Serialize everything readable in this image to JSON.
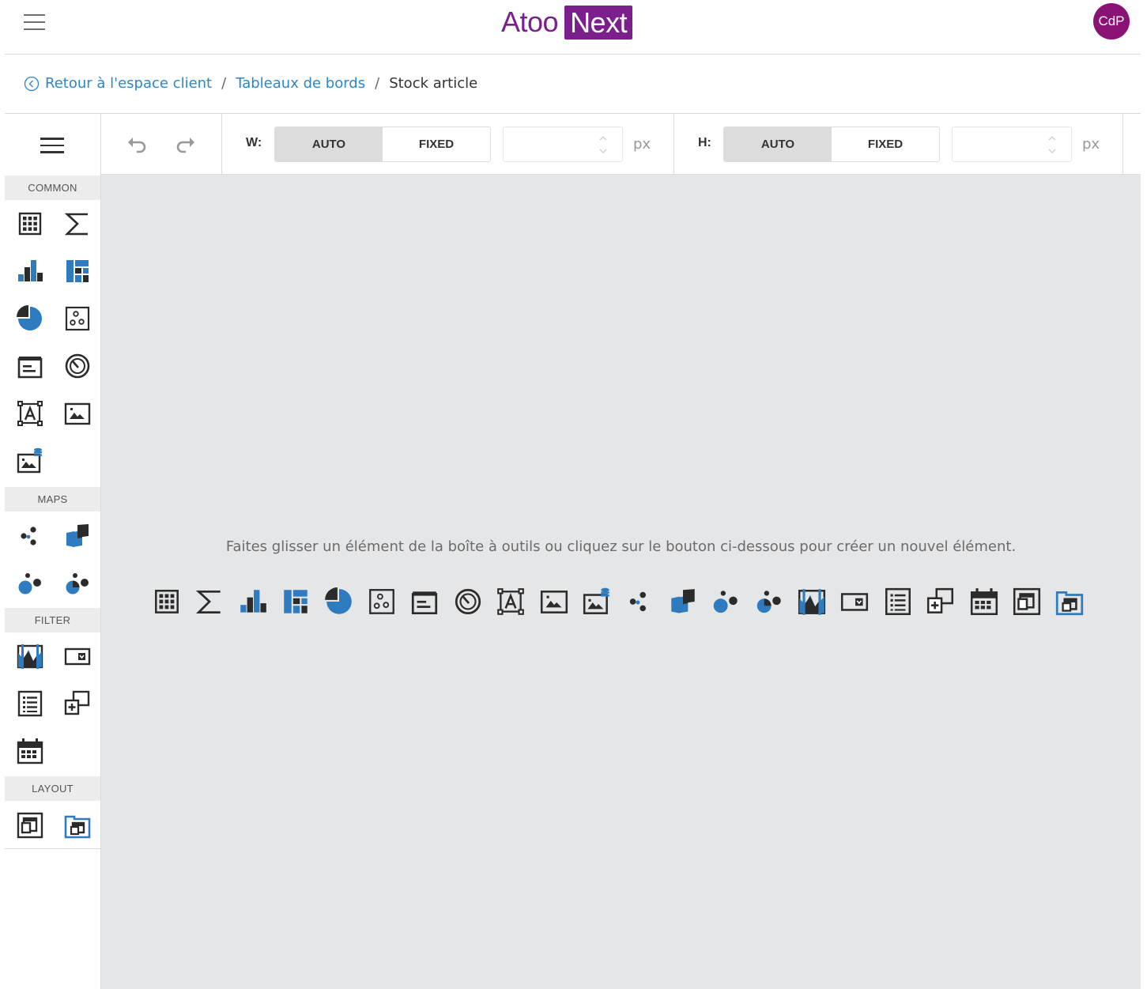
{
  "header": {
    "menu_icon": "hamburger-icon",
    "logo_text": "Atoo",
    "logo_box_text": "Next",
    "logo_color": "#7a1f8c",
    "avatar_initials": "CdP",
    "avatar_color": "#8b1275"
  },
  "breadcrumb": {
    "back_icon": "back-circle-icon",
    "back_label": "Retour à l'espace client",
    "separator": "/",
    "parent_label": "Tableaux de bords",
    "current_label": "Stock article",
    "link_color": "#2e86c6"
  },
  "toolbox": {
    "menu_icon": "hamburger-icon",
    "groups": [
      {
        "label": "COMMON",
        "items": [
          "grid-icon",
          "card-sum-icon",
          "chart-icon",
          "treemap-icon",
          "pie-icon",
          "scatter-icon",
          "text-box-icon",
          "gauge-icon",
          "bound-image-text-icon",
          "image-icon",
          "bound-image-icon"
        ]
      },
      {
        "label": "MAPS",
        "items": [
          "geo-point-map-icon",
          "choropleth-map-icon",
          "bubble-map-icon",
          "pie-map-icon"
        ]
      },
      {
        "label": "FILTER",
        "items": [
          "range-filter-icon",
          "combo-box-icon",
          "list-box-icon",
          "tree-view-icon",
          "date-filter-icon"
        ]
      },
      {
        "label": "LAYOUT",
        "items": [
          "group-icon",
          "tab-container-icon"
        ]
      }
    ]
  },
  "options": {
    "undo_icon": "undo-icon",
    "redo_icon": "redo-icon",
    "width": {
      "label": "W:",
      "auto": "AUTO",
      "fixed": "FIXED",
      "selected": "AUTO",
      "value": "",
      "unit": "px"
    },
    "height": {
      "label": "H:",
      "auto": "AUTO",
      "fixed": "FIXED",
      "selected": "AUTO",
      "value": "",
      "unit": "px"
    }
  },
  "canvas": {
    "hint": "Faites glisser un élément de la boîte à outils ou cliquez sur le bouton ci-dessous pour créer un nouvel élément.",
    "background": "#e5e6e8",
    "quick_items": [
      "grid-icon",
      "card-sum-icon",
      "chart-icon",
      "treemap-icon",
      "pie-icon",
      "scatter-icon",
      "text-box-icon",
      "gauge-icon",
      "bound-image-text-icon",
      "image-icon",
      "bound-image-icon",
      "geo-point-map-icon",
      "choropleth-map-icon",
      "bubble-map-icon",
      "pie-map-icon",
      "range-filter-icon",
      "combo-box-icon",
      "list-box-icon",
      "tree-view-icon",
      "date-filter-icon",
      "group-icon",
      "tab-container-icon"
    ]
  },
  "colors": {
    "accent_blue": "#2e7bbf",
    "icon_dark": "#2b2b2b"
  }
}
